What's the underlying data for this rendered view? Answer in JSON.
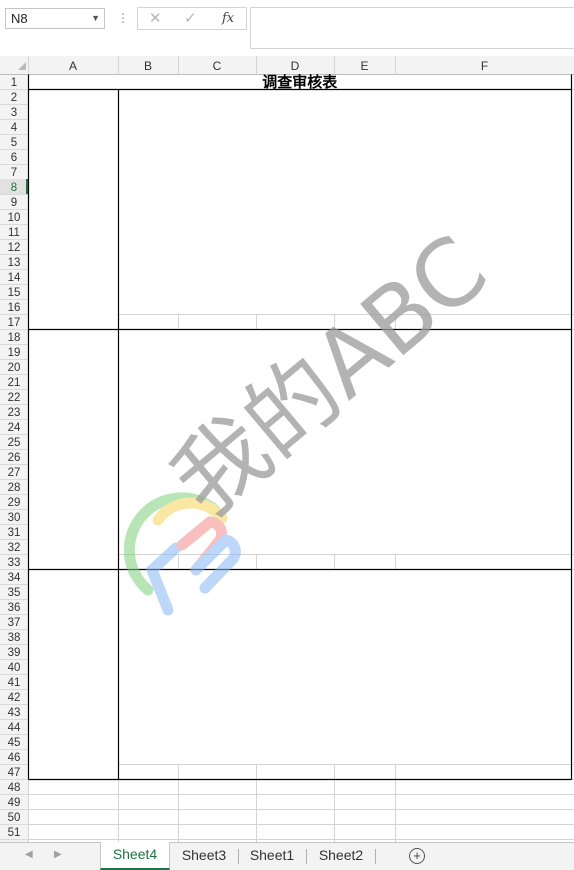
{
  "name_box": {
    "value": "N8"
  },
  "formula_bar": {
    "cancel": "✕",
    "enter": "✓",
    "fx": "fx",
    "value": ""
  },
  "columns": [
    "A",
    "B",
    "C",
    "D",
    "E",
    "F"
  ],
  "rows": [
    "1",
    "2",
    "3",
    "4",
    "5",
    "6",
    "7",
    "8",
    "9",
    "10",
    "11",
    "12",
    "13",
    "14",
    "15",
    "16",
    "17",
    "18",
    "19",
    "20",
    "21",
    "22",
    "23",
    "24",
    "25",
    "26",
    "27",
    "28",
    "29",
    "30",
    "31",
    "32",
    "33",
    "34",
    "35",
    "36",
    "37",
    "38",
    "39",
    "40",
    "41",
    "42",
    "43",
    "44",
    "45",
    "46",
    "47",
    "48",
    "49",
    "50",
    "51"
  ],
  "selected_row": "8",
  "sheet_title": "调查审核表",
  "watermark": {
    "text": "我的ABC"
  },
  "tabs": [
    {
      "label": "Sheet4",
      "active": true
    },
    {
      "label": "Sheet3",
      "active": false
    },
    {
      "label": "Sheet1",
      "active": false
    },
    {
      "label": "Sheet2",
      "active": false
    }
  ],
  "colors": {
    "accent": "#217346",
    "grid": "#d4d4d4",
    "header_bg": "#f3f3f3"
  }
}
